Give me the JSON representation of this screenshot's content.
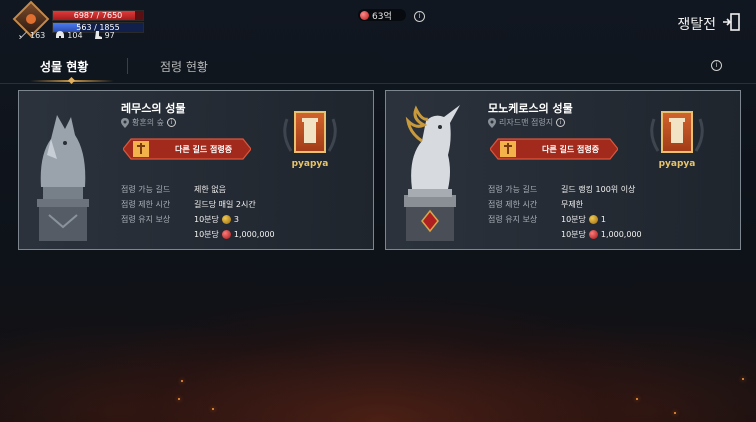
{
  "player": {
    "hp_text": "6987 / 7650",
    "hp_fraction": 0.913,
    "mp_text": "563 / 1855",
    "mp_fraction": 0.303,
    "stats": [
      {
        "icon": "sword-icon",
        "value": "163"
      },
      {
        "icon": "helmet-icon",
        "value": "104"
      },
      {
        "icon": "boot-icon",
        "value": "97"
      }
    ]
  },
  "currency": {
    "icon": "red-gem-icon",
    "value": "63억"
  },
  "header": {
    "title": "쟁탈전",
    "exit_icon": "exit-door-icon"
  },
  "tabs": [
    {
      "label": "성물 현황",
      "active": true
    },
    {
      "label": "점령 현황",
      "active": false
    }
  ],
  "castles": [
    {
      "name": "레무스의 성물",
      "location": "황혼의 숲",
      "status": "다른 길드 점령중",
      "guild_name": "pyapya",
      "rows": [
        {
          "label": "점령 가능 길드",
          "value": "제한 없음"
        },
        {
          "label": "점령 제한 시간",
          "value": "길드당 매일 2시간"
        },
        {
          "label": "점령 유지 보상",
          "per": "10분당",
          "icon": "coin-icon",
          "value": "3"
        },
        {
          "label": "",
          "per": "10분당",
          "icon": "red-gem-icon",
          "value": "1,000,000"
        }
      ]
    },
    {
      "name": "모노케로스의 성물",
      "location": "리자드맨 점령지",
      "status": "다른 길드 점령중",
      "guild_name": "pyapya",
      "rows": [
        {
          "label": "점령 가능 길드",
          "value": "길드 랭킹 100위 이상"
        },
        {
          "label": "점령 제한 시간",
          "value": "무제한"
        },
        {
          "label": "점령 유지 보상",
          "per": "10분당",
          "icon": "coin-icon",
          "value": "1"
        },
        {
          "label": "",
          "per": "10분당",
          "icon": "red-gem-icon",
          "value": "1,000,000"
        }
      ]
    }
  ],
  "colors": {
    "accent": "#c99747",
    "hp": "#d02a2a",
    "mp": "#3a63d0",
    "guild_name": "#e7c46a",
    "status_banner": "#c8321e"
  }
}
